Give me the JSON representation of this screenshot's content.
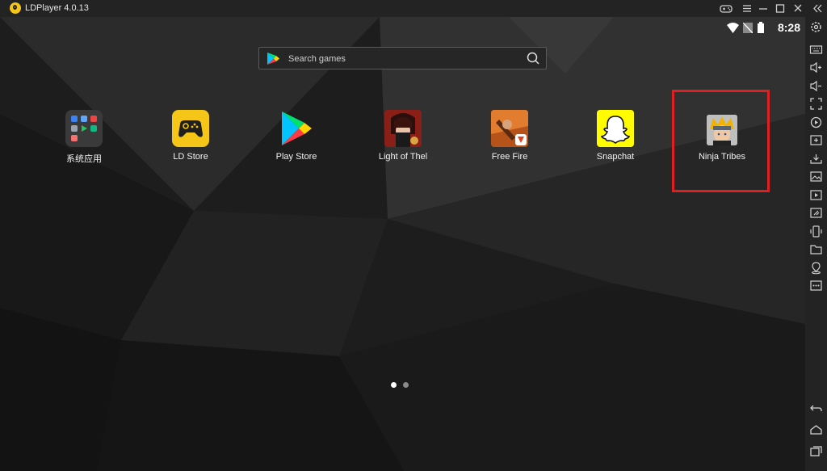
{
  "window": {
    "title": "LDPlayer 4.0.13"
  },
  "status_bar": {
    "time": "8:28"
  },
  "search": {
    "placeholder": "Search games"
  },
  "apps": [
    {
      "label": "系统应用"
    },
    {
      "label": "LD Store"
    },
    {
      "label": "Play Store"
    },
    {
      "label": "Light of Thel"
    },
    {
      "label": "Free Fire"
    },
    {
      "label": "Snapchat"
    },
    {
      "label": "Ninja Tribes"
    }
  ],
  "pagination": {
    "pages": 2,
    "current": 1
  },
  "colors": {
    "accent": "#f5c518",
    "highlight": "#e02020",
    "snapchat": "#fffc00"
  }
}
